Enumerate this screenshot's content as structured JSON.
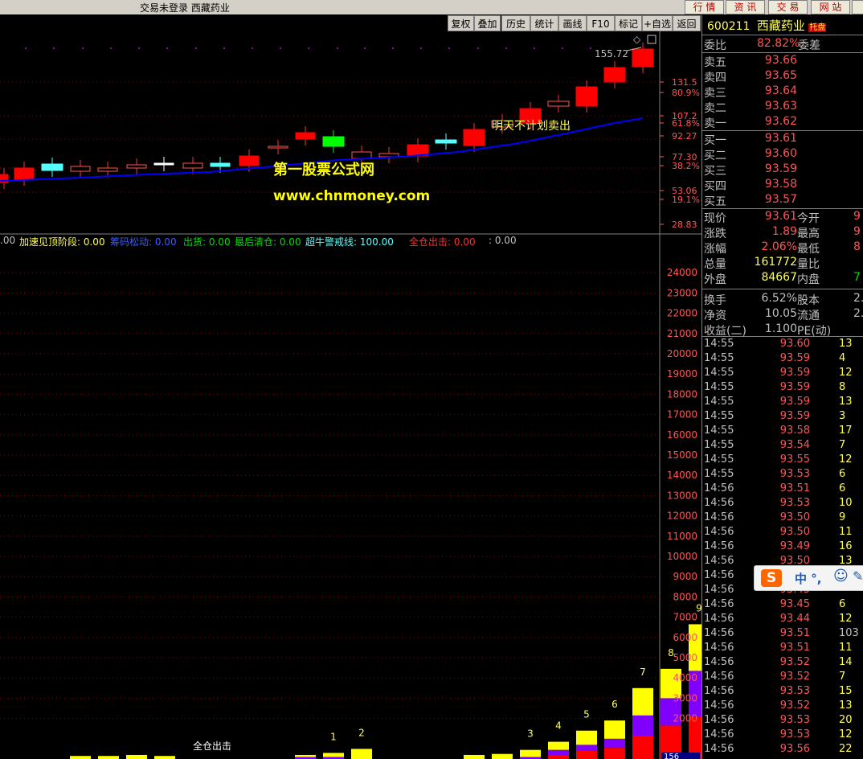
{
  "window": {
    "title": "交易未登录  西藏药业",
    "nav": [
      "行 情",
      "资 讯",
      "交 易",
      "网 站"
    ]
  },
  "toolbar": [
    "复权",
    "叠加",
    "历史",
    "统计",
    "画线",
    "F10",
    "标记",
    "+自选",
    "返回"
  ],
  "stock": {
    "code": "600211",
    "name": "西藏药业",
    "badge": "托盘"
  },
  "orderbook": {
    "weibi_label": "委比",
    "weibi_value": "82.82%",
    "weicha_label": "委差",
    "sell": [
      {
        "label": "卖五",
        "price": "93.66"
      },
      {
        "label": "卖四",
        "price": "93.65"
      },
      {
        "label": "卖三",
        "price": "93.64"
      },
      {
        "label": "卖二",
        "price": "93.63"
      },
      {
        "label": "卖一",
        "price": "93.62"
      }
    ],
    "buy": [
      {
        "label": "买一",
        "price": "93.61"
      },
      {
        "label": "买二",
        "price": "93.60"
      },
      {
        "label": "买三",
        "price": "93.59"
      },
      {
        "label": "买四",
        "price": "93.58"
      },
      {
        "label": "买五",
        "price": "93.57"
      }
    ]
  },
  "quote": {
    "rows": [
      {
        "l1": "现价",
        "v1": "93.61",
        "l2": "今开",
        "v2": "9"
      },
      {
        "l1": "涨跌",
        "v1": "1.89",
        "l2": "最高",
        "v2": "9"
      },
      {
        "l1": "涨幅",
        "v1": "2.06%",
        "l2": "最低",
        "v2": "8"
      },
      {
        "l1": "总量",
        "v1": "161772",
        "l2": "量比",
        "v2": ""
      },
      {
        "l1": "外盘",
        "v1": "84667",
        "l2": "内盘",
        "v2": "7"
      }
    ],
    "rows2": [
      {
        "l1": "换手",
        "v1": "6.52%",
        "l2": "股本",
        "v2": "2."
      },
      {
        "l1": "净资",
        "v1": "10.05",
        "l2": "流通",
        "v2": "2."
      },
      {
        "l1": "收益(二)",
        "v1": "1.100",
        "l2": "PE(动)",
        "v2": ""
      }
    ]
  },
  "ticks": [
    {
      "t": "14:55",
      "p": "93.60",
      "v": "13"
    },
    {
      "t": "14:55",
      "p": "93.59",
      "v": "4"
    },
    {
      "t": "14:55",
      "p": "93.59",
      "v": "12"
    },
    {
      "t": "14:55",
      "p": "93.59",
      "v": "8"
    },
    {
      "t": "14:55",
      "p": "93.59",
      "v": "13"
    },
    {
      "t": "14:55",
      "p": "93.59",
      "v": "3"
    },
    {
      "t": "14:55",
      "p": "93.58",
      "v": "17"
    },
    {
      "t": "14:55",
      "p": "93.54",
      "v": "7"
    },
    {
      "t": "14:55",
      "p": "93.55",
      "v": "12"
    },
    {
      "t": "14:55",
      "p": "93.53",
      "v": "6"
    },
    {
      "t": "14:56",
      "p": "93.51",
      "v": "6"
    },
    {
      "t": "14:56",
      "p": "93.53",
      "v": "10"
    },
    {
      "t": "14:56",
      "p": "93.50",
      "v": "9"
    },
    {
      "t": "14:56",
      "p": "93.50",
      "v": "11"
    },
    {
      "t": "14:56",
      "p": "93.49",
      "v": "16"
    },
    {
      "t": "14:56",
      "p": "93.50",
      "v": "13"
    },
    {
      "t": "14:56",
      "p": "",
      "v": ""
    },
    {
      "t": "14:56",
      "p": "93.45",
      "v": ""
    },
    {
      "t": "14:56",
      "p": "93.45",
      "v": "6"
    },
    {
      "t": "14:56",
      "p": "93.44",
      "v": "12"
    },
    {
      "t": "14:56",
      "p": "93.51",
      "v": "103"
    },
    {
      "t": "14:56",
      "p": "93.51",
      "v": "11"
    },
    {
      "t": "14:56",
      "p": "93.52",
      "v": "14"
    },
    {
      "t": "14:56",
      "p": "93.52",
      "v": "7"
    },
    {
      "t": "14:56",
      "p": "93.53",
      "v": "15"
    },
    {
      "t": "14:56",
      "p": "93.52",
      "v": "13"
    },
    {
      "t": "14:56",
      "p": "93.53",
      "v": "20"
    },
    {
      "t": "14:56",
      "p": "93.53",
      "v": "12"
    },
    {
      "t": "14:56",
      "p": "93.56",
      "v": "22"
    }
  ],
  "ime": {
    "text": "中 °,"
  },
  "price_chart": {
    "y_labels": [
      "131.5",
      "80.9%",
      "107.2",
      "61.8%",
      "92.27",
      "77.30",
      "38.2%",
      "53.06",
      "19.1%",
      "28.83"
    ],
    "peak_label": "155.72",
    "annotation": "明天不计划卖出",
    "watermark_line1": "第一股票公式网",
    "watermark_line2": "www.chnmoney.com"
  },
  "indicator": {
    "prefix": ".00",
    "items": [
      {
        "name": "加速见顶阶段",
        "value": "0.00",
        "color": "#ffff54"
      },
      {
        "name": "筹码松动",
        "value": "0.00",
        "color": "#3a5cff"
      },
      {
        "name": "出货",
        "value": "0.00",
        "color": "#00e000"
      },
      {
        "name": "最后清仓",
        "value": "0.00",
        "color": "#00e000"
      },
      {
        "name": "超牛警戒线",
        "value": "100.00",
        "color": "#54ffff"
      },
      {
        "name": "全仓出击",
        "value": "0.00",
        "color": "#ff3030"
      },
      {
        "name": "",
        "value": "0.00",
        "color": "#c0c0c0"
      }
    ]
  },
  "chart_data": {
    "type": "bar",
    "title": "",
    "y_ticks": [
      2000,
      3000,
      4000,
      5000,
      6000,
      7000,
      8000,
      9000,
      10000,
      11000,
      12000,
      13000,
      14000,
      15000,
      16000,
      17000,
      18000,
      19000,
      20000,
      21000,
      22000,
      23000,
      24000
    ],
    "ylim": [
      0,
      25200
    ],
    "series": [
      {
        "name": "",
        "color": "#ff0000",
        "values": [
          0,
          0,
          0,
          0,
          0,
          0,
          0,
          0,
          0,
          0,
          0,
          0,
          0,
          0,
          0,
          0,
          0,
          200,
          400,
          550,
          1150,
          1650,
          2100,
          3500
        ]
      },
      {
        "name": "",
        "color": "#8000ff",
        "values": [
          0,
          0,
          0,
          0,
          0,
          0,
          0,
          0,
          100,
          100,
          0,
          0,
          0,
          0,
          0,
          0,
          100,
          250,
          300,
          450,
          1000,
          1350,
          2250,
          3500
        ]
      },
      {
        "name": "",
        "color": "#ffff00",
        "values": [
          150,
          150,
          200,
          150,
          0,
          0,
          0,
          0,
          100,
          200,
          500,
          0,
          0,
          0,
          200,
          250,
          350,
          400,
          700,
          900,
          1350,
          1450,
          2300,
          3500
        ]
      }
    ],
    "bar_labels": [
      {
        "index": 9,
        "text": "1"
      },
      {
        "index": 10,
        "text": "2"
      },
      {
        "index": 16,
        "text": "3"
      },
      {
        "index": 17,
        "text": "4"
      },
      {
        "index": 18,
        "text": "5"
      },
      {
        "index": 19,
        "text": "6"
      },
      {
        "index": 20,
        "text": "7"
      },
      {
        "index": 21,
        "text": "8"
      },
      {
        "index": 22,
        "text": "9"
      }
    ],
    "marker_text": "全仓出击",
    "bottom_tag": "156"
  }
}
